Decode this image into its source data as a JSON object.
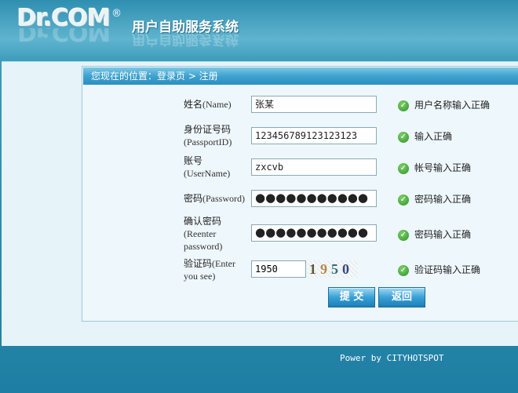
{
  "header": {
    "logo": "Dr.COM",
    "registered": "®",
    "system_title": "用户自助服务系统"
  },
  "breadcrumb": "您现在的位置：登录页 > 注册",
  "form": {
    "fields": [
      {
        "label": "姓名",
        "sub": "(Name)",
        "value": "张某",
        "status": "用户名称输入正确"
      },
      {
        "label": "身份证号码",
        "sub": "(PassportID)",
        "value": "123456789123123123",
        "status": "输入正确"
      },
      {
        "label": "账号",
        "sub": "(UserName)",
        "value": "zxcvb",
        "status": "帐号输入正确"
      },
      {
        "label": "密码",
        "sub": "(Password)",
        "value": "●●●●●●●●●●●",
        "status": "密码输入正确"
      },
      {
        "label": "确认密码",
        "sub1": "(Reenter",
        "sub2": "password)",
        "value": "●●●●●●●●●●●",
        "status": "密码输入正确"
      },
      {
        "label": "验证码",
        "sub1": "(Enter",
        "sub2": "you see)",
        "value": "1950",
        "status": "验证码输入正确"
      }
    ],
    "captcha": {
      "d1": "1",
      "d2": "9",
      "d3": "5",
      "d4": "0"
    }
  },
  "buttons": {
    "submit": "提 交",
    "back": "返回"
  },
  "footer": "Power by CITYHOTSPOT",
  "colors": {
    "accent": "#3fa2cf",
    "ok": "#2f8f2a"
  },
  "icons": {
    "status": "check-circle-icon"
  }
}
